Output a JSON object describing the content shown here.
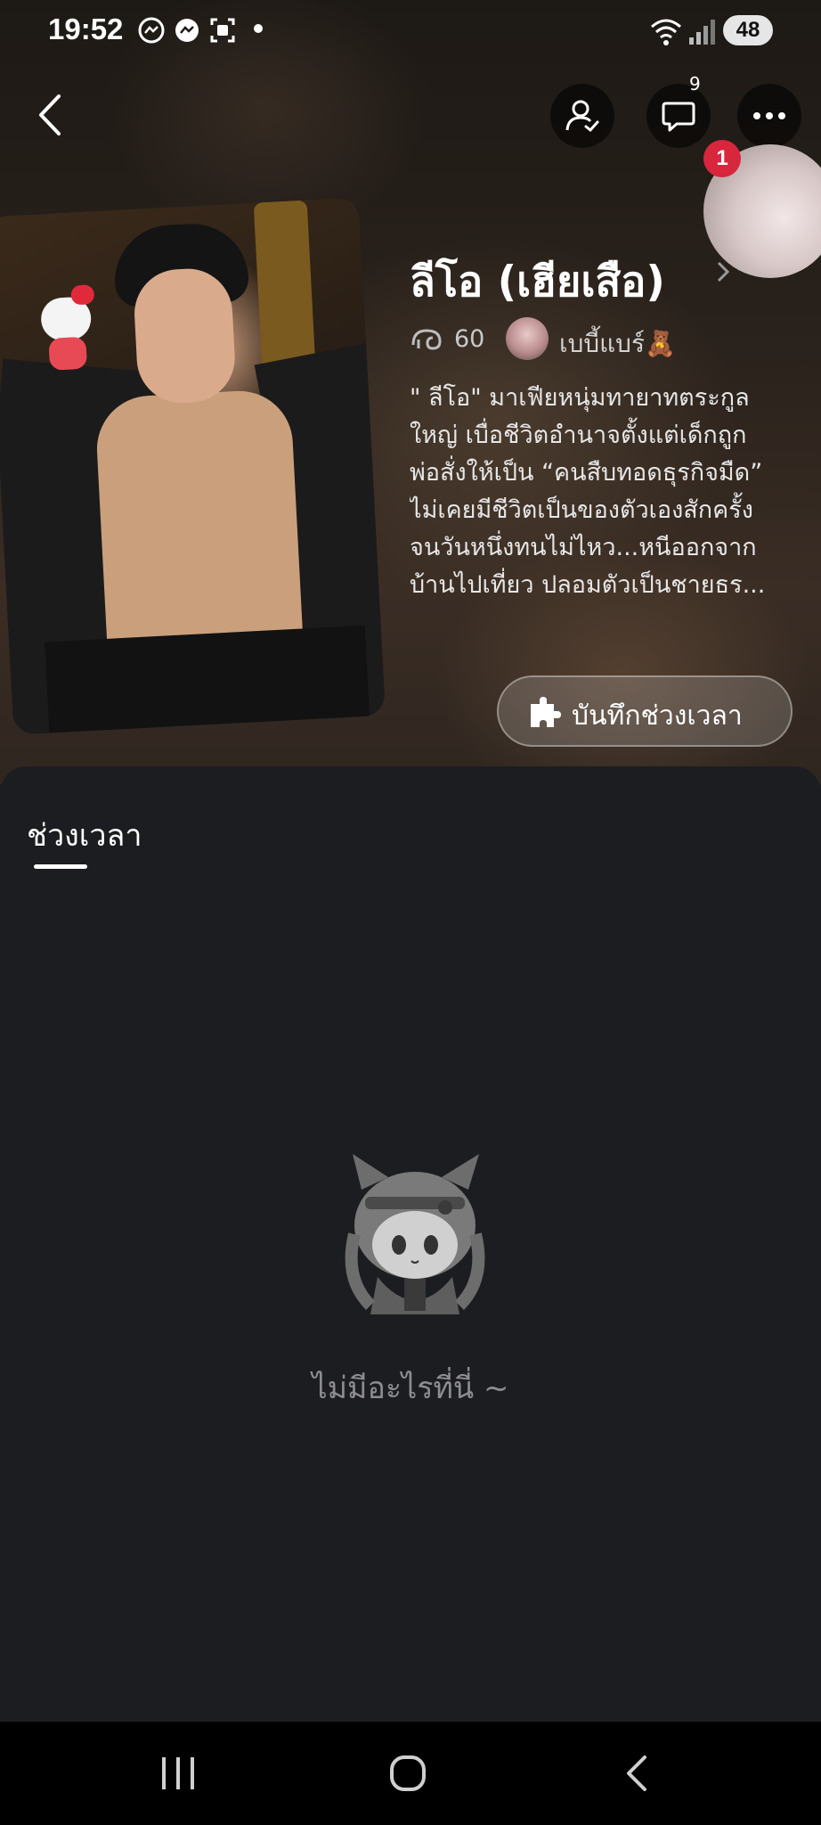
{
  "status_bar": {
    "time": "19:52",
    "battery": "48"
  },
  "header": {
    "comment_count": "9",
    "notification_badge": "1"
  },
  "story": {
    "title": "ลีโอ (เฮียเสือ)",
    "view_count": "60",
    "author_name": "เบบี้แบร์🧸",
    "description_lines": [
      "\" ลีโอ\" มาเฟียหนุ่มทายาทตระกูล",
      "ใหญ่ เบื่อชีวิตอำนาจตั้งแต่เด็กถูก",
      "พ่อสั่งให้เป็น “คนสืบทอดธุรกิจมืด”",
      "ไม่เคยมีชีวิตเป็นของตัวเองสักครั้ง",
      "จนวันหนึ่งทนไม่ไหว...หนีออกจาก",
      "บ้านไปเที่ยว ปลอมตัวเป็นชายธร..."
    ],
    "save_button": "บันทึกช่วงเวลา"
  },
  "tabs": {
    "active": "ช่วงเวลา"
  },
  "empty_state": {
    "message": "ไม่มีอะไรที่นี่ ~"
  },
  "colors": {
    "background": "#1c1d20",
    "badge": "#d8263d",
    "muted_text": "#8d8d90"
  }
}
